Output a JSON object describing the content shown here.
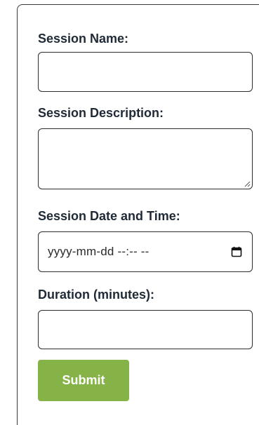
{
  "form": {
    "session_name_label": "Session Name:",
    "session_description_label": "Session Description:",
    "session_datetime_label": "Session Date and Time:",
    "duration_label": "Duration (minutes):",
    "session_name_value": "",
    "session_description_value": "",
    "session_datetime_placeholder": "yyyy-mm-dd --:-- --",
    "duration_value": "",
    "submit_label": "Submit"
  },
  "colors": {
    "submit_bg": "#86b347",
    "label_text": "#1f2a36",
    "field_border": "#2d2d2d"
  },
  "icons": {
    "date_picker": "calendar-icon"
  }
}
